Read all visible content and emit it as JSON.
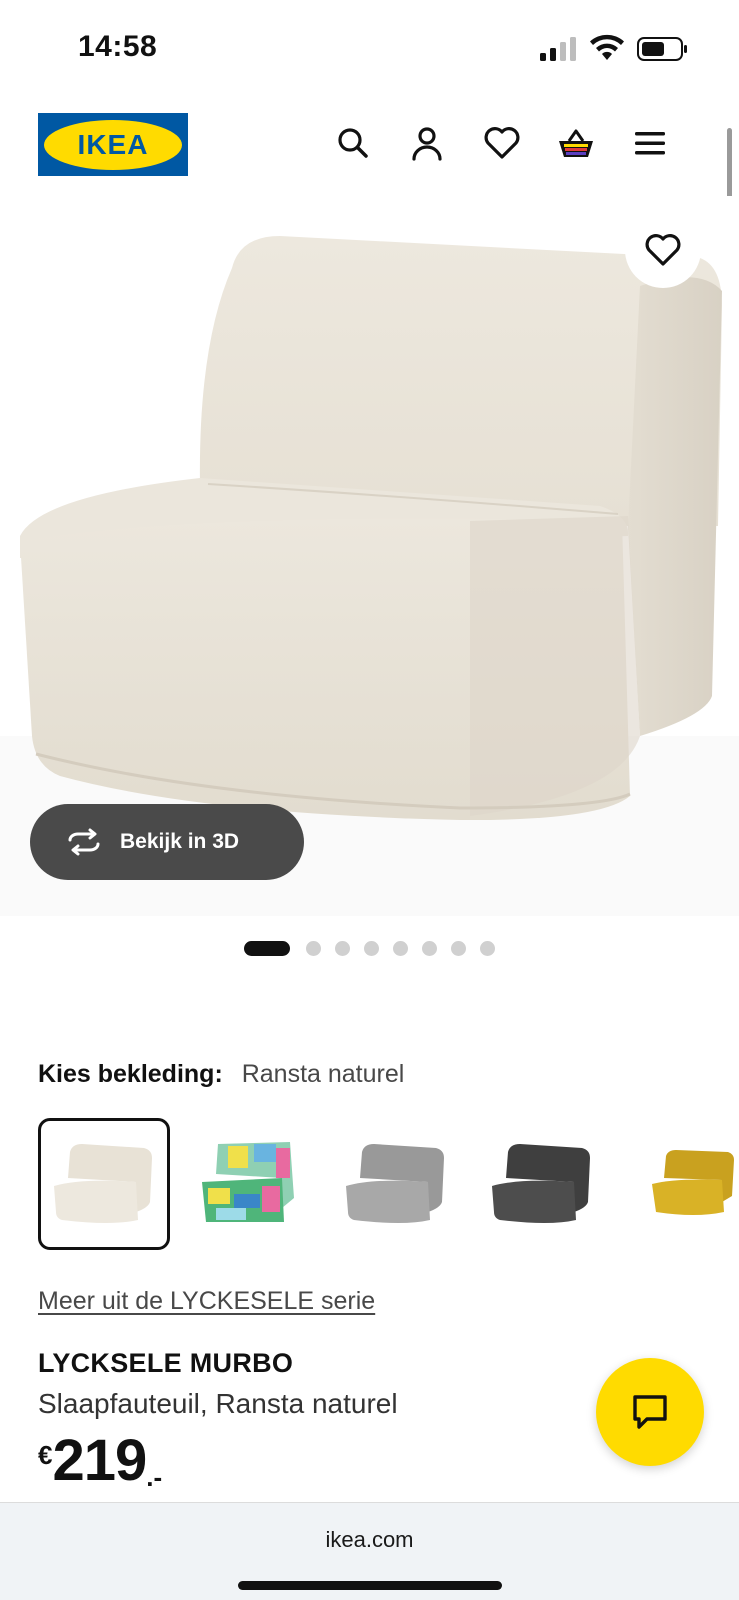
{
  "status_bar": {
    "time": "14:58"
  },
  "header": {
    "logo_text": "IKEA",
    "icons": [
      "search-icon",
      "account-icon",
      "heart-icon",
      "basket-icon",
      "menu-icon"
    ]
  },
  "hero": {
    "view_3d_label": "Bekijk in 3D",
    "slide_count": 8,
    "active_slide": 1
  },
  "fabric": {
    "label": "Kies bekleding:",
    "value": "Ransta naturel",
    "swatches": [
      {
        "name": "Ransta naturel",
        "color": "#ece6db",
        "selected": true
      },
      {
        "name": "multicolor",
        "color": "#7dc7a8",
        "selected": false
      },
      {
        "name": "grijs",
        "color": "#a3a3a3",
        "selected": false
      },
      {
        "name": "donkergrijs",
        "color": "#4d4d4d",
        "selected": false
      },
      {
        "name": "geel",
        "color": "#d9b226",
        "selected": false
      }
    ]
  },
  "series_link": "Meer uit de LYCKESELE serie",
  "product": {
    "name": "LYCKSELE MURBO",
    "description": "Slaapfauteuil, Ransta naturel",
    "price_currency": "€",
    "price_integer": "219",
    "price_decimal": ".-"
  },
  "browser": {
    "url": "ikea.com"
  },
  "colors": {
    "brand_blue": "#0058a3",
    "brand_yellow": "#ffdb00",
    "button_dark": "#4a4a4a"
  }
}
